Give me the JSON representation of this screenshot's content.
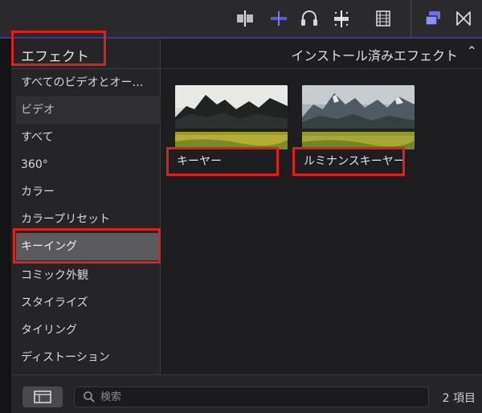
{
  "sidebar": {
    "title": "エフェクト",
    "items": [
      {
        "label": "すべてのビデオとオー…",
        "kind": "item"
      },
      {
        "label": "ビデオ",
        "kind": "section"
      },
      {
        "label": "すべて",
        "kind": "item"
      },
      {
        "label": "360°",
        "kind": "item"
      },
      {
        "label": "カラー",
        "kind": "item"
      },
      {
        "label": "カラープリセット",
        "kind": "item"
      },
      {
        "label": "キーイング",
        "kind": "selected"
      },
      {
        "label": "コミック外観",
        "kind": "item"
      },
      {
        "label": "スタイライズ",
        "kind": "item"
      },
      {
        "label": "タイリング",
        "kind": "item"
      },
      {
        "label": "ディストーション",
        "kind": "item"
      }
    ]
  },
  "content": {
    "filter_label": "インストール済みエフェクト",
    "effects": [
      {
        "label": "キーヤー"
      },
      {
        "label": "ルミナンスキーヤー"
      }
    ]
  },
  "bottombar": {
    "search_placeholder": "検索",
    "count": "2 項目"
  },
  "colors": {
    "accent": "#6f6fe0",
    "highlight": "#e0201e",
    "selected_bg": "#5b5b5e"
  }
}
